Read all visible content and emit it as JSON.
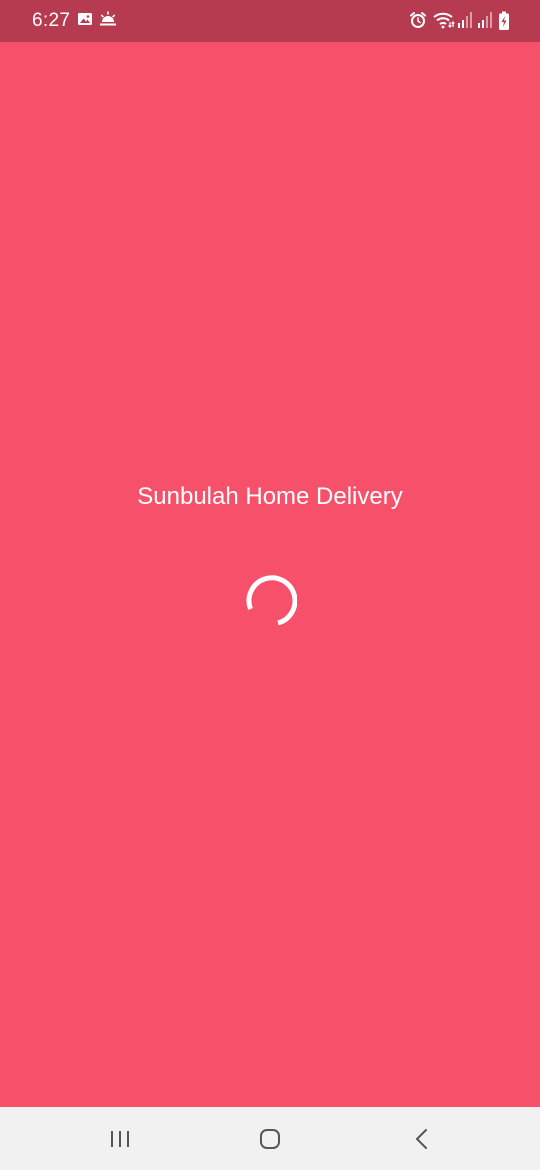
{
  "status_bar": {
    "time": "6:27",
    "left_icons": [
      "image-icon",
      "weather-sunrise-icon"
    ],
    "right_icons": [
      "alarm-icon",
      "wifi-icon",
      "signal-icon",
      "signal-icon",
      "battery-charging-icon"
    ],
    "background_color": "#b63b50"
  },
  "splash": {
    "title": "Sunbulah Home Delivery",
    "background_color": "#f6506a",
    "loading_indicator": "spinner-icon"
  },
  "nav_bar": {
    "buttons": [
      "recent-apps-icon",
      "home-icon",
      "back-icon"
    ],
    "background_color": "#f1f1f1"
  }
}
